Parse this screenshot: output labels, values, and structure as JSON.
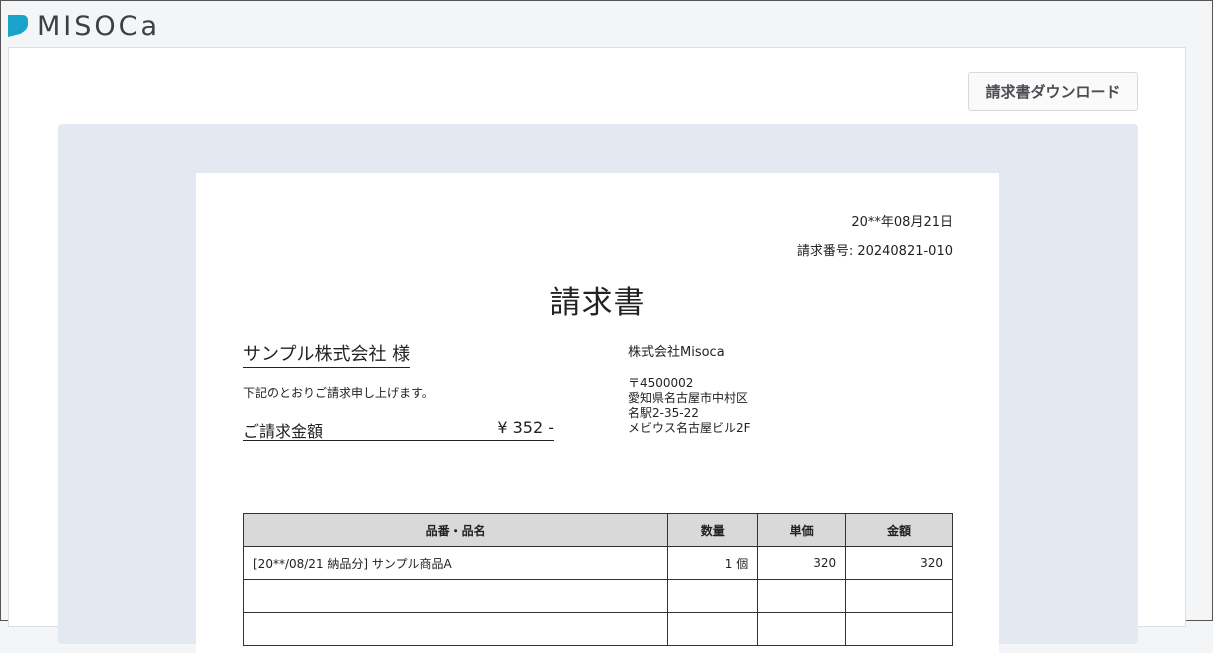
{
  "app": {
    "logo_text": "MISOCa",
    "brand_color": "#1aa3c9"
  },
  "toolbar": {
    "download_label": "請求書ダウンロード"
  },
  "invoice": {
    "date": "20**年08月21日",
    "number": "請求番号: 20240821-010",
    "title": "請求書",
    "client": "サンプル株式会社 様",
    "lead_text": "下記のとおりご請求申し上げます。",
    "amount_label": "ご請求金額",
    "amount_value": "¥ 352 -",
    "issuer": {
      "name": "株式会社Misoca",
      "address": [
        "〒4500002",
        "愛知県名古屋市中村区",
        "名駅2-35-22",
        "メビウス名古屋ビル2F"
      ]
    },
    "table": {
      "headers": [
        "品番・品名",
        "数量",
        "単価",
        "金額"
      ],
      "rows": [
        [
          "[20**/08/21 納品分] サンプル商品A",
          "1 個",
          "320",
          "320"
        ],
        [
          "",
          "",
          "",
          ""
        ],
        [
          "",
          "",
          "",
          ""
        ]
      ]
    }
  }
}
